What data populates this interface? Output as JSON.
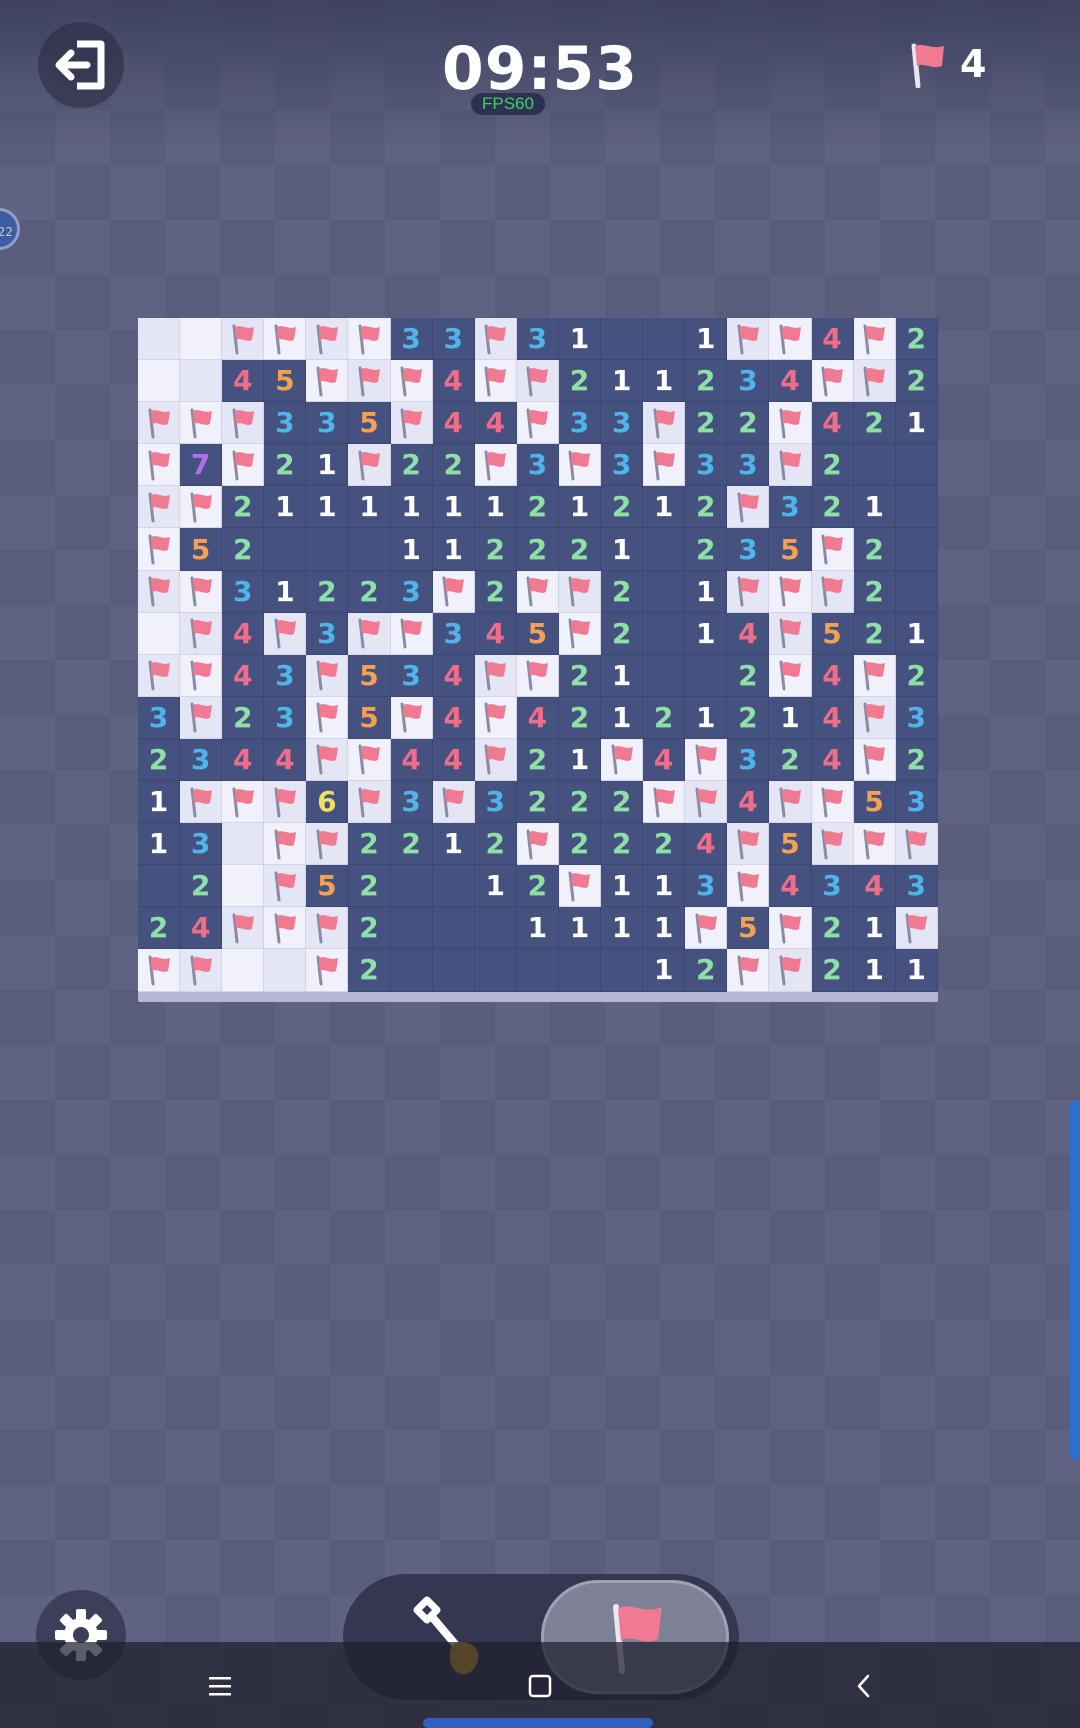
{
  "header": {
    "timer": "09:53",
    "fps_label": "FPS60",
    "flags_remaining": "4"
  },
  "side_bubble_text": "22",
  "colors": {
    "revealed_cell": "#45527f",
    "unrevealed_cell": "#e4e6f5",
    "flag": "#f07a92",
    "n1": "#ffffff",
    "n2": "#8fe0a6",
    "n3": "#4fb4ea",
    "n4": "#f06d8a",
    "n5": "#f5a153",
    "n6": "#f0e060",
    "n7": "#b06df0"
  },
  "board": {
    "columns": 19,
    "rows_count": 16,
    "legend": "U = unrevealed, F = flagged, 0 = revealed empty, 1-8 = revealed number",
    "rows": [
      [
        "U",
        "U",
        "F",
        "F",
        "F",
        "F",
        "3",
        "3",
        "F",
        "3",
        "1",
        "0",
        "0",
        "1",
        "F",
        "F",
        "4",
        "F",
        "2"
      ],
      [
        "U",
        "U",
        "4",
        "5",
        "F",
        "F",
        "F",
        "4",
        "F",
        "F",
        "2",
        "1",
        "1",
        "2",
        "3",
        "4",
        "F",
        "F",
        "2"
      ],
      [
        "F",
        "F",
        "F",
        "3",
        "3",
        "5",
        "F",
        "4",
        "4",
        "F",
        "3",
        "3",
        "F",
        "2",
        "2",
        "F",
        "4",
        "2",
        "1"
      ],
      [
        "F",
        "7",
        "F",
        "2",
        "1",
        "F",
        "2",
        "2",
        "F",
        "3",
        "F",
        "3",
        "F",
        "3",
        "3",
        "F",
        "2",
        "0",
        "0"
      ],
      [
        "F",
        "F",
        "2",
        "1",
        "1",
        "1",
        "1",
        "1",
        "1",
        "2",
        "1",
        "2",
        "1",
        "2",
        "F",
        "3",
        "2",
        "1",
        "0"
      ],
      [
        "F",
        "5",
        "2",
        "0",
        "0",
        "0",
        "1",
        "1",
        "2",
        "2",
        "2",
        "1",
        "0",
        "2",
        "3",
        "5",
        "F",
        "2",
        "0"
      ],
      [
        "F",
        "F",
        "3",
        "1",
        "2",
        "2",
        "3",
        "F",
        "2",
        "F",
        "F",
        "2",
        "0",
        "1",
        "F",
        "F",
        "F",
        "2",
        "0"
      ],
      [
        "U",
        "F",
        "4",
        "F",
        "3",
        "F",
        "F",
        "3",
        "4",
        "5",
        "F",
        "2",
        "0",
        "1",
        "4",
        "F",
        "5",
        "2",
        "1"
      ],
      [
        "F",
        "F",
        "4",
        "3",
        "F",
        "5",
        "3",
        "4",
        "F",
        "F",
        "2",
        "1",
        "0",
        "0",
        "2",
        "F",
        "4",
        "F",
        "2"
      ],
      [
        "3",
        "F",
        "2",
        "3",
        "F",
        "5",
        "F",
        "4",
        "F",
        "4",
        "2",
        "1",
        "2",
        "1",
        "2",
        "1",
        "4",
        "F",
        "3"
      ],
      [
        "2",
        "3",
        "4",
        "4",
        "F",
        "F",
        "4",
        "4",
        "F",
        "2",
        "1",
        "F",
        "4",
        "F",
        "3",
        "2",
        "4",
        "F",
        "2"
      ],
      [
        "1",
        "F",
        "F",
        "F",
        "6",
        "F",
        "3",
        "F",
        "3",
        "2",
        "2",
        "2",
        "F",
        "F",
        "4",
        "F",
        "F",
        "5",
        "3"
      ],
      [
        "1",
        "3",
        "U",
        "F",
        "F",
        "2",
        "2",
        "1",
        "2",
        "F",
        "2",
        "2",
        "2",
        "4",
        "F",
        "5",
        "F",
        "F",
        "F"
      ],
      [
        "0",
        "2",
        "U",
        "F",
        "5",
        "2",
        "0",
        "0",
        "1",
        "2",
        "F",
        "1",
        "1",
        "3",
        "F",
        "4",
        "3",
        "4",
        "3"
      ],
      [
        "2",
        "4",
        "F",
        "F",
        "F",
        "2",
        "0",
        "0",
        "0",
        "1",
        "1",
        "1",
        "1",
        "F",
        "5",
        "F",
        "2",
        "1",
        "F"
      ],
      [
        "F",
        "F",
        "U",
        "U",
        "F",
        "2",
        "0",
        "0",
        "0",
        "0",
        "0",
        "0",
        "1",
        "2",
        "F",
        "F",
        "2",
        "1",
        "1"
      ]
    ]
  },
  "tools": {
    "dig": "shovel-icon",
    "flag": "flag-icon",
    "selected": "flag"
  },
  "navbar": {
    "menu": "menu-icon",
    "home": "home-icon",
    "back": "back-icon"
  }
}
